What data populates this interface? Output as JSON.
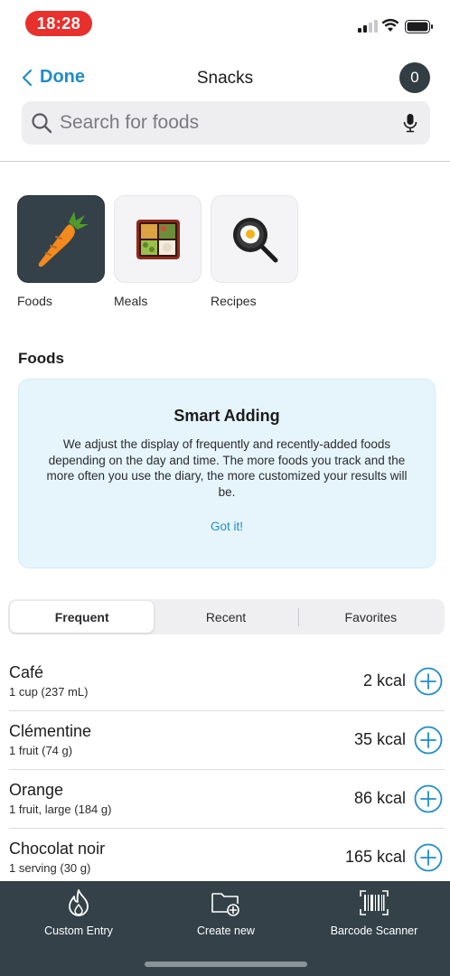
{
  "status": {
    "time": "18:28"
  },
  "nav": {
    "back_label": "Done",
    "title": "Snacks",
    "count": "0"
  },
  "search": {
    "placeholder": "Search for foods"
  },
  "categories": [
    {
      "label": "Foods",
      "icon": "carrot-icon",
      "selected": true
    },
    {
      "label": "Meals",
      "icon": "bento-box-icon",
      "selected": false
    },
    {
      "label": "Recipes",
      "icon": "frying-pan-icon",
      "selected": false
    }
  ],
  "section_title": "Foods",
  "info_card": {
    "title": "Smart Adding",
    "body": "We adjust the display of frequently and recently-added foods depending on the day and time. The more foods you track and the more often you use the diary, the more customized your results will be.",
    "action": "Got it!"
  },
  "tabs": [
    {
      "label": "Frequent",
      "active": true
    },
    {
      "label": "Recent",
      "active": false
    },
    {
      "label": "Favorites",
      "active": false
    }
  ],
  "foods": [
    {
      "name": "Café",
      "serving": "1 cup (237 mL)",
      "kcal": "2 kcal"
    },
    {
      "name": "Clémentine",
      "serving": "1 fruit (74 g)",
      "kcal": "35 kcal"
    },
    {
      "name": "Orange",
      "serving": "1 fruit, large (184 g)",
      "kcal": "86 kcal"
    },
    {
      "name": "Chocolat noir",
      "serving": "1 serving (30 g)",
      "kcal": "165 kcal"
    }
  ],
  "bottom_bar": {
    "custom_entry": "Custom Entry",
    "create_new": "Create new",
    "barcode_scanner": "Barcode Scanner"
  },
  "colors": {
    "accent": "#1f8cc9",
    "dark": "#344149",
    "info_bg": "#e6f5fc",
    "status_red": "#e8302d"
  }
}
